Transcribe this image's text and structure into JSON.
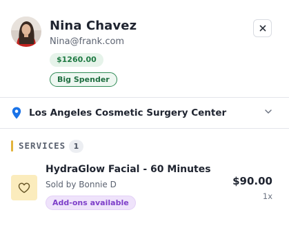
{
  "customer": {
    "name": "Nina Chavez",
    "email": "Nina@frank.com",
    "spend_badge": "$1260.00",
    "tag": "Big Spender",
    "avatar_icon": "customer-photo"
  },
  "controls": {
    "close_icon": "close-icon"
  },
  "location": {
    "name": "Los Angeles Cosmetic Surgery Center",
    "pin_color": "#1a73e8",
    "chevron_icon": "chevron-down-icon"
  },
  "services": {
    "title": "SERVICES",
    "count": "1",
    "accent_color": "#e2b33b",
    "items": [
      {
        "name": "HydraGlow Facial - 60 Minutes",
        "seller": "Sold by Bonnie D",
        "addon_badge": "Add-ons available",
        "price": "$90.00",
        "quantity": "1x",
        "icon": "heart-icon"
      }
    ]
  },
  "colors": {
    "spend_badge_bg": "#e6f3ea",
    "spend_badge_text": "#1f7a43",
    "tag_border": "#2f8a55",
    "addon_bg": "#efe3fb",
    "addon_text": "#7e3fc9",
    "service_icon_bg": "#fbecbd"
  }
}
